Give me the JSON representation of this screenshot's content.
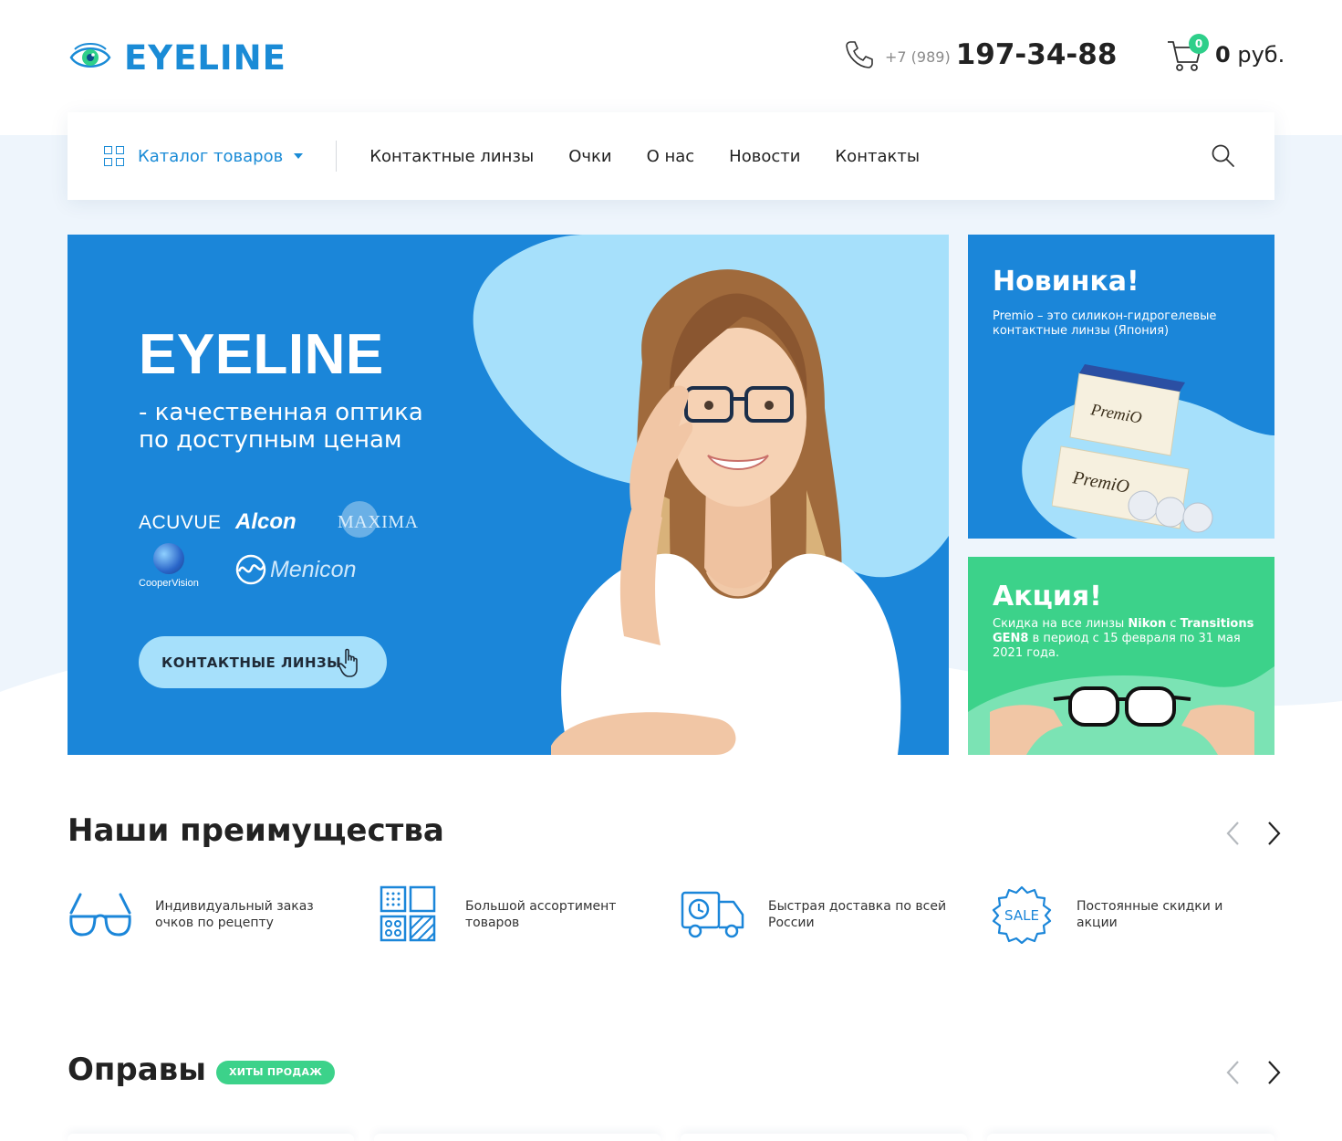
{
  "header": {
    "logo_text": "EYELINE",
    "phone_prefix": "+7 (989)",
    "phone_number": "197-34-88",
    "cart_count": "0",
    "cart_total_value": "0",
    "cart_total_unit": "руб."
  },
  "nav": {
    "catalog_label": "Каталог товаров",
    "links": [
      "Контактные линзы",
      "Очки",
      "О нас",
      "Новости",
      "Контакты"
    ]
  },
  "hero": {
    "title": "EYELINE",
    "subtitle": "- качественная оптика по доступным ценам",
    "brands": {
      "acuvue": "ACUVUE",
      "alcon": "Alcon",
      "maxima": "MAXIMA",
      "coopervision": "CooperVision",
      "menicon": "Menicon"
    },
    "button_label": "КОНТАКТНЫЕ ЛИНЗЫ"
  },
  "promo_new": {
    "title": "Новинка!",
    "text": "Premio – это силикон-гидрогелевые контактные линзы (Япония)",
    "product_label": "PremiO"
  },
  "promo_sale": {
    "title": "Акция!",
    "text_part1": "Скидка на все линзы ",
    "brand1": "Nikon",
    "text_part2": " с ",
    "brand2": "Transitions GEN8",
    "text_part3": " в период с 15 февраля по 31 мая 2021 года."
  },
  "advantages": {
    "title": "Наши преимущества",
    "items": [
      {
        "text": "Индивидуальный заказ очков по рецепту",
        "icon": "glasses-icon"
      },
      {
        "text": "Большой ассортимент товаров",
        "icon": "assortment-icon"
      },
      {
        "text": "Быстрая доставка по всей России",
        "icon": "delivery-truck-icon"
      },
      {
        "text": "Постоянные скидки и акции",
        "icon": "sale-badge-icon",
        "badge_text": "SALE"
      }
    ]
  },
  "frames": {
    "title": "Оправы",
    "badge": "ХИТЫ ПРОДАЖ"
  },
  "colors": {
    "brand_blue": "#1b86d9",
    "light_blue": "#a6e0fb",
    "green": "#3cd28a",
    "text": "#222222"
  }
}
